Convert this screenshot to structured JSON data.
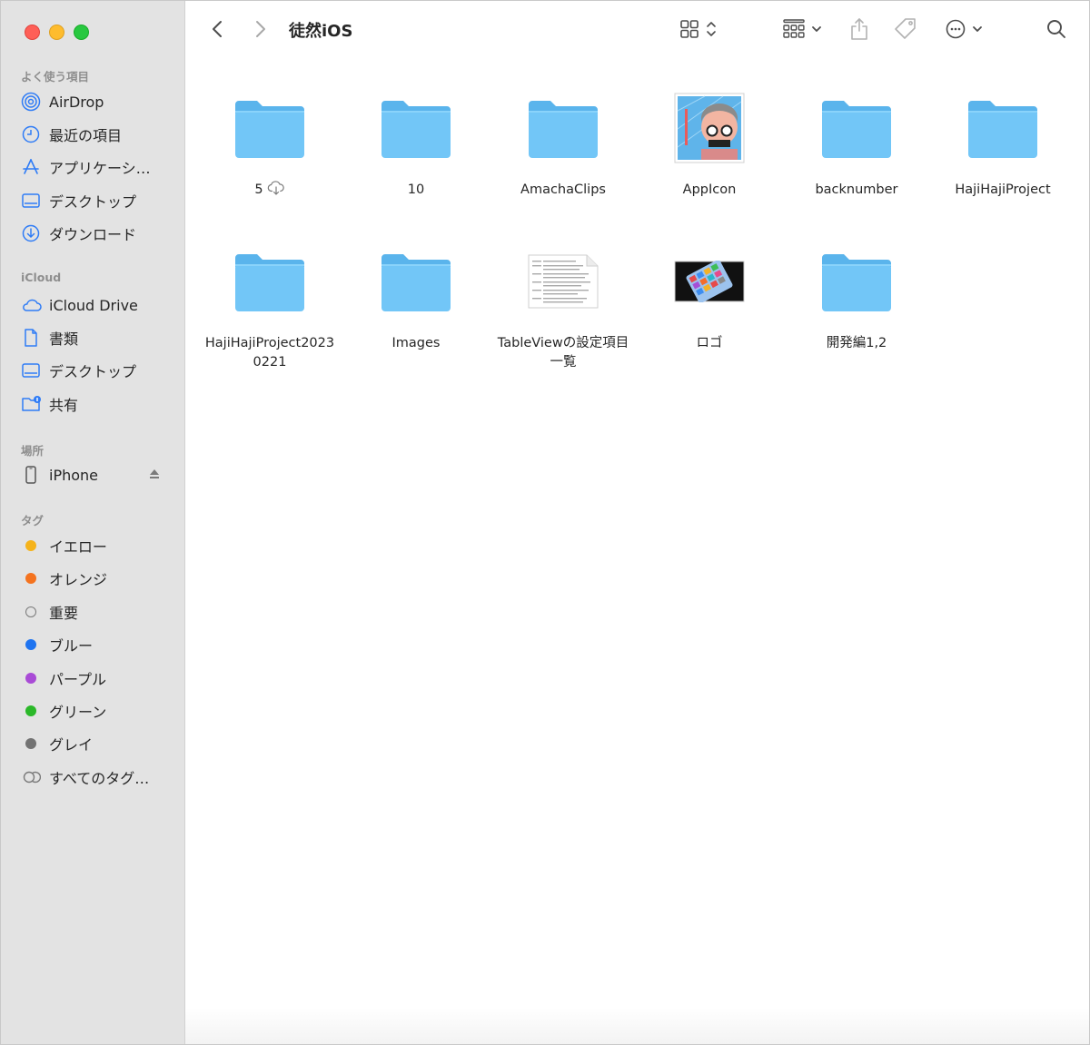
{
  "window": {
    "title": "徒然iOS"
  },
  "sidebar": {
    "favorites_header": "よく使う項目",
    "favorites": [
      {
        "label": "AirDrop",
        "icon": "airdrop-icon"
      },
      {
        "label": "最近の項目",
        "icon": "clock-icon"
      },
      {
        "label": "アプリケーシ…",
        "icon": "applications-icon"
      },
      {
        "label": "デスクトップ",
        "icon": "desktop-icon"
      },
      {
        "label": "ダウンロード",
        "icon": "download-icon"
      }
    ],
    "icloud_header": "iCloud",
    "icloud": [
      {
        "label": "iCloud Drive",
        "icon": "icloud-icon"
      },
      {
        "label": "書類",
        "icon": "document-icon"
      },
      {
        "label": "デスクトップ",
        "icon": "desktop-icon"
      },
      {
        "label": "共有",
        "icon": "shared-folder-icon"
      }
    ],
    "locations_header": "場所",
    "locations": [
      {
        "label": "iPhone",
        "icon": "iphone-icon"
      }
    ],
    "tags_header": "タグ",
    "tags": [
      {
        "label": "イエロー",
        "color": "#f5b31b"
      },
      {
        "label": "オレンジ",
        "color": "#f4731f"
      },
      {
        "label": "重要",
        "color": ""
      },
      {
        "label": "ブルー",
        "color": "#1f74f0"
      },
      {
        "label": "パープル",
        "color": "#a94bd6"
      },
      {
        "label": "グリーン",
        "color": "#2bb829"
      },
      {
        "label": "グレイ",
        "color": "#737373"
      },
      {
        "label": "すべてのタグ…",
        "color": ""
      }
    ]
  },
  "items": [
    {
      "name": "5",
      "kind": "folder",
      "cloud": true
    },
    {
      "name": "10",
      "kind": "folder"
    },
    {
      "name": "AmachaClips",
      "kind": "folder"
    },
    {
      "name": "AppIcon",
      "kind": "app-icon-image"
    },
    {
      "name": "backnumber",
      "kind": "folder"
    },
    {
      "name": "HajiHajiProject",
      "kind": "folder"
    },
    {
      "name": "HajiHajiProject20230221",
      "kind": "folder"
    },
    {
      "name": "Images",
      "kind": "folder"
    },
    {
      "name": "TableViewの設定項目一覧",
      "kind": "document"
    },
    {
      "name": "ロゴ",
      "kind": "logo-image"
    },
    {
      "name": "開発編1,2",
      "kind": "folder"
    }
  ],
  "colors": {
    "folder_body": "#72c6f7",
    "folder_tab": "#5ab4ec",
    "sidebar_icon": "#2f7cf6",
    "sidebar_bg": "#e3e3e3"
  }
}
